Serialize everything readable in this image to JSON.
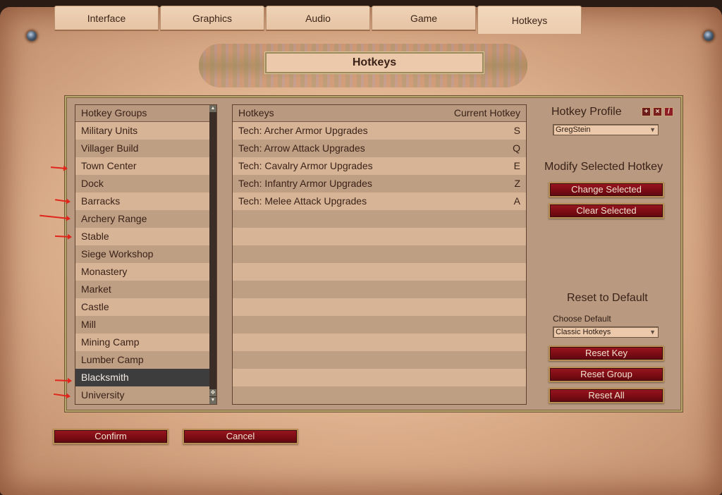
{
  "tabs": [
    {
      "label": "Interface",
      "active": false
    },
    {
      "label": "Graphics",
      "active": false
    },
    {
      "label": "Audio",
      "active": false
    },
    {
      "label": "Game",
      "active": false
    },
    {
      "label": "Hotkeys",
      "active": true
    }
  ],
  "title": "Hotkeys",
  "groups": {
    "header": "Hotkey Groups",
    "items": [
      {
        "label": "Military Units",
        "selected": false
      },
      {
        "label": "Villager Build",
        "selected": false
      },
      {
        "label": "Town Center",
        "selected": false
      },
      {
        "label": "Dock",
        "selected": false
      },
      {
        "label": "Barracks",
        "selected": false
      },
      {
        "label": "Archery Range",
        "selected": false
      },
      {
        "label": "Stable",
        "selected": false
      },
      {
        "label": "Siege Workshop",
        "selected": false
      },
      {
        "label": "Monastery",
        "selected": false
      },
      {
        "label": "Market",
        "selected": false
      },
      {
        "label": "Castle",
        "selected": false
      },
      {
        "label": "Mill",
        "selected": false
      },
      {
        "label": "Mining Camp",
        "selected": false
      },
      {
        "label": "Lumber Camp",
        "selected": false
      },
      {
        "label": "Blacksmith",
        "selected": true
      },
      {
        "label": "University",
        "selected": false
      }
    ]
  },
  "hotkeys": {
    "header_name": "Hotkeys",
    "header_key": "Current Hotkey",
    "rows": [
      {
        "name": "Tech: Archer Armor Upgrades",
        "key": "S"
      },
      {
        "name": "Tech: Arrow Attack Upgrades",
        "key": "Q"
      },
      {
        "name": "Tech: Cavalry Armor Upgrades",
        "key": "E"
      },
      {
        "name": "Tech: Infantry Armor Upgrades",
        "key": "Z"
      },
      {
        "name": "Tech: Melee Attack Upgrades",
        "key": "A"
      }
    ],
    "empty_rows": 11
  },
  "profile": {
    "title": "Hotkey Profile",
    "selected": "GregStein",
    "icons": {
      "add": "+",
      "delete": "×",
      "edit": "/"
    }
  },
  "modify": {
    "title": "Modify Selected Hotkey",
    "change_label": "Change Selected",
    "clear_label": "Clear Selected"
  },
  "reset": {
    "title": "Reset to Default",
    "choose_label": "Choose Default",
    "selected_default": "Classic Hotkeys",
    "reset_key_label": "Reset Key",
    "reset_group_label": "Reset Group",
    "reset_all_label": "Reset All"
  },
  "footer": {
    "confirm_label": "Confirm",
    "cancel_label": "Cancel"
  },
  "annotations": {
    "arrow_color": "#e0261c",
    "marked_groups": [
      "Town Center",
      "Barracks",
      "Archery Range",
      "Stable",
      "Blacksmith",
      "University"
    ]
  }
}
